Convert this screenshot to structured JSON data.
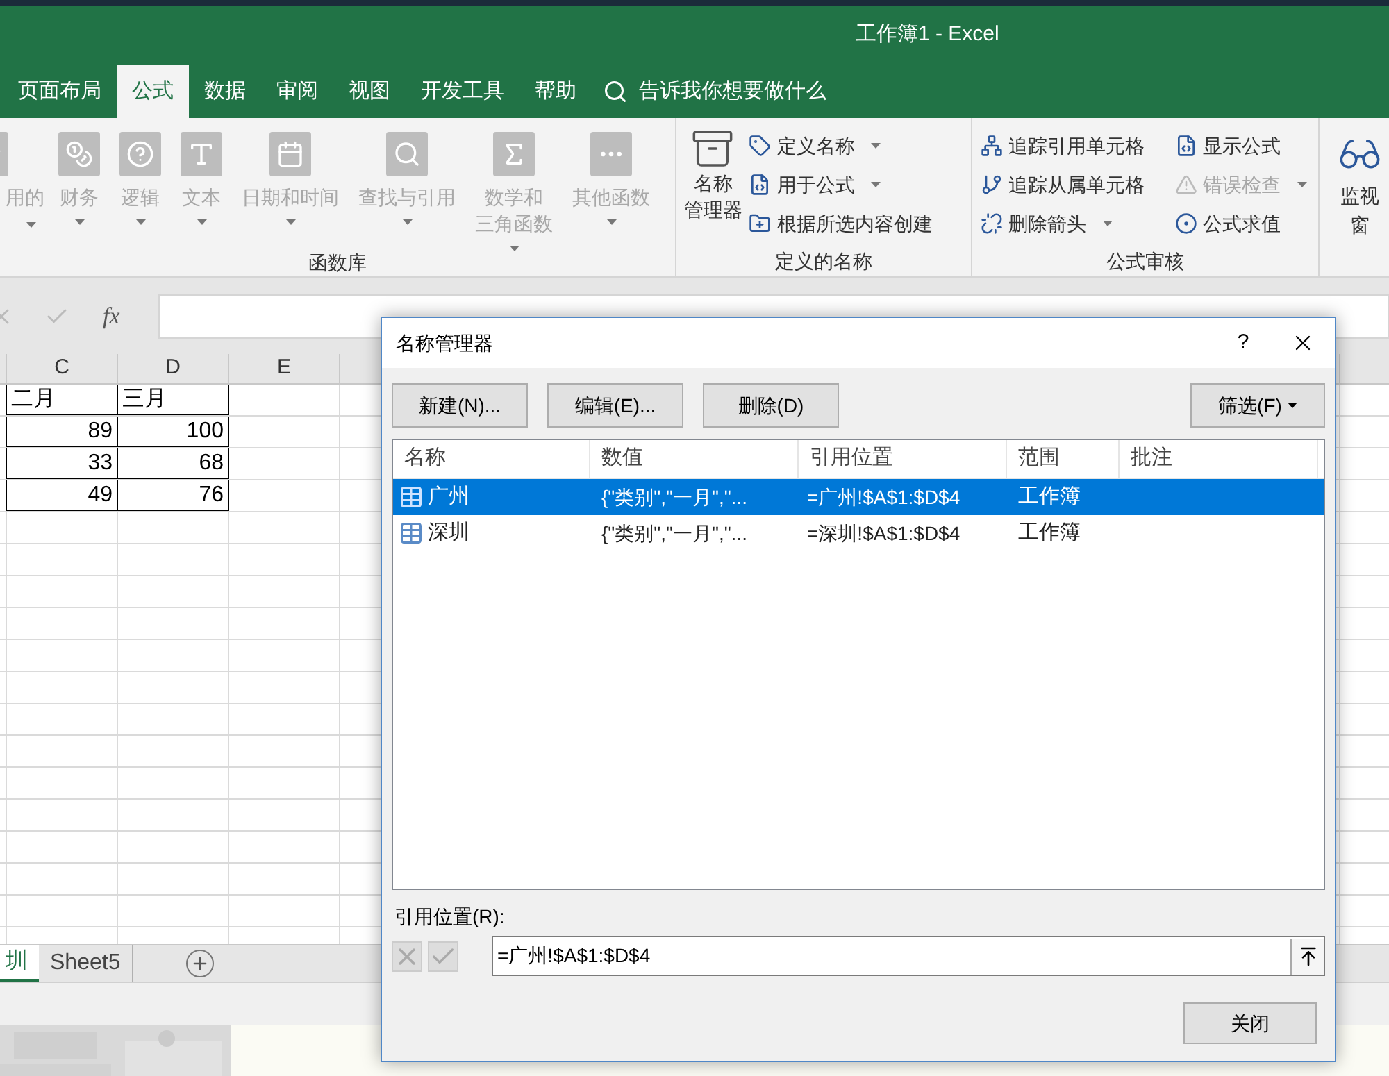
{
  "window": {
    "title": "工作簿1 - Excel"
  },
  "ribbon_tabs": [
    {
      "label": "页面布局",
      "selected": false
    },
    {
      "label": "公式",
      "selected": true
    },
    {
      "label": "数据",
      "selected": false
    },
    {
      "label": "审阅",
      "selected": false
    },
    {
      "label": "视图",
      "selected": false
    },
    {
      "label": "开发工具",
      "selected": false
    },
    {
      "label": "帮助",
      "selected": false
    }
  ],
  "tell_me": {
    "placeholder": "告诉我你想要做什么"
  },
  "function_library": {
    "label": "函数库",
    "buttons": [
      {
        "lines": [
          "用的"
        ],
        "dropdown": true,
        "disabled": true
      },
      {
        "lines": [
          "财务"
        ],
        "dropdown": true,
        "disabled": true
      },
      {
        "lines": [
          "逻辑"
        ],
        "dropdown": true,
        "disabled": true
      },
      {
        "lines": [
          "文本"
        ],
        "dropdown": true,
        "disabled": true
      },
      {
        "lines": [
          "日期和时间"
        ],
        "dropdown": true,
        "disabled": true
      },
      {
        "lines": [
          "查找与引用"
        ],
        "dropdown": true,
        "disabled": true
      },
      {
        "lines": [
          "数学和",
          "三角函数"
        ],
        "dropdown": true,
        "disabled": true
      },
      {
        "lines": [
          "其他函数"
        ],
        "dropdown": true,
        "disabled": true
      }
    ]
  },
  "defined_names": {
    "label": "定义的名称",
    "big_button": {
      "lines": [
        "名称",
        "管理器"
      ]
    },
    "items": [
      {
        "label": "定义名称",
        "dropdown": true,
        "disabled": false
      },
      {
        "label": "用于公式",
        "dropdown": true,
        "disabled": false
      },
      {
        "label": "根据所选内容创建",
        "dropdown": false,
        "disabled": false
      }
    ]
  },
  "formula_auditing": {
    "label": "公式审核",
    "items": [
      {
        "label": "追踪引用单元格",
        "dropdown": false,
        "disabled": false
      },
      {
        "label": "显示公式",
        "dropdown": false,
        "disabled": false
      },
      {
        "label": "追踪从属单元格",
        "dropdown": false,
        "disabled": false
      },
      {
        "label": "错误检查",
        "dropdown": true,
        "disabled": true
      },
      {
        "label": "删除箭头",
        "dropdown": true,
        "disabled": false
      },
      {
        "label": "公式求值",
        "dropdown": false,
        "disabled": false
      }
    ]
  },
  "watch_window": {
    "label": "监视窗"
  },
  "formula_bar": {
    "fx": "fx"
  },
  "sheet": {
    "columns": [
      "C",
      "D",
      "E"
    ],
    "rows": [
      [
        "二月",
        "三月"
      ],
      [
        "89",
        "100"
      ],
      [
        "33",
        "68"
      ],
      [
        "49",
        "76"
      ]
    ]
  },
  "sheet_tabs": [
    {
      "label": "圳",
      "selected": true
    },
    {
      "label": "Sheet5",
      "selected": false
    }
  ],
  "dialog": {
    "title": "名称管理器",
    "help": "?",
    "buttons": [
      "新建(N)...",
      "编辑(E)...",
      "删除(D)"
    ],
    "filter": "筛选(F)",
    "columns": [
      "名称",
      "数值",
      "引用位置",
      "范围",
      "批注"
    ],
    "rows": [
      {
        "name": "广州",
        "value": "{\"类别\",\"一月\",\"...",
        "refers_to": "=广州!$A$1:$D$4",
        "scope": "工作簿",
        "selected": true
      },
      {
        "name": "深圳",
        "value": "{\"类别\",\"一月\",\"...",
        "refers_to": "=深圳!$A$1:$D$4",
        "scope": "工作簿",
        "selected": false
      }
    ],
    "refers_label": "引用位置(R):",
    "refers_value": "=广州!$A$1:$D$4",
    "close": "关闭"
  }
}
